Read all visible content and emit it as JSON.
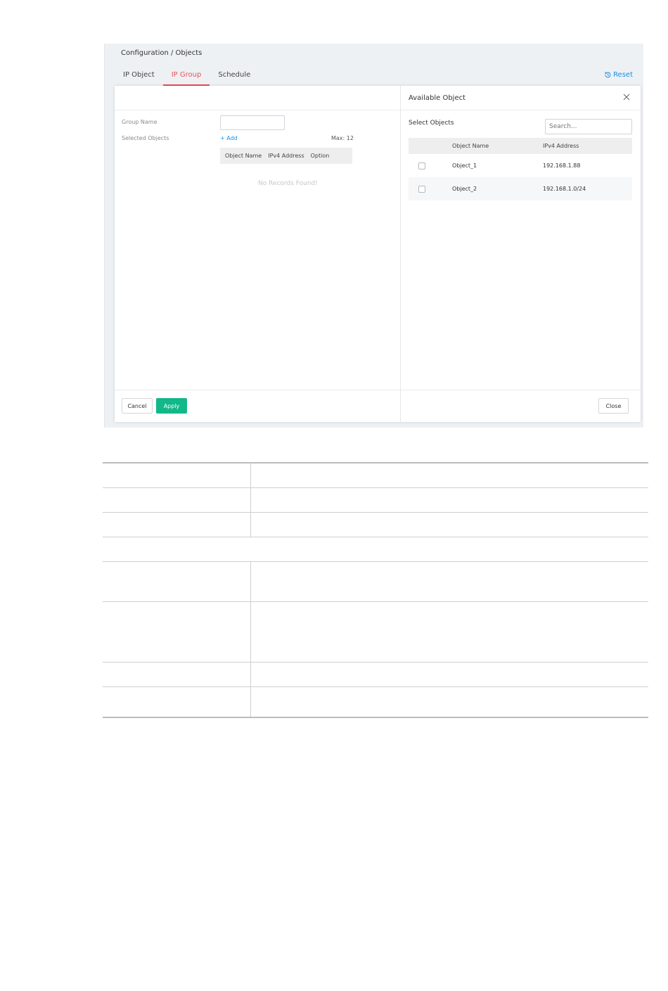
{
  "breadcrumb": "Configuration / Objects",
  "tabs": [
    {
      "label": "IP Object",
      "active": false
    },
    {
      "label": "IP Group",
      "active": true
    },
    {
      "label": "Schedule",
      "active": false
    }
  ],
  "reset_label": "Reset",
  "left_pane": {
    "group_name_label": "Group Name",
    "group_name_value": "",
    "selected_objects_label": "Selected Objects",
    "add_label": "+ Add",
    "max_label": "Max: 12",
    "columns": [
      "Object Name",
      "IPv4 Address",
      "Option"
    ],
    "empty_text": "No Records Found!",
    "cancel_label": "Cancel",
    "apply_label": "Apply"
  },
  "right_pane": {
    "title": "Available Object",
    "select_objects_label": "Select Objects",
    "search_placeholder": "Search...",
    "columns": [
      "Object Name",
      "IPv4 Address"
    ],
    "rows": [
      {
        "name": "Object_1",
        "ip": "192.168.1.88",
        "checked": false
      },
      {
        "name": "Object_2",
        "ip": "192.168.1.0/24",
        "checked": false
      }
    ],
    "close_label": "Close"
  },
  "colors": {
    "accent_red": "#e8505b",
    "link_blue": "#1a8fe0",
    "apply_green": "#13b88a"
  }
}
